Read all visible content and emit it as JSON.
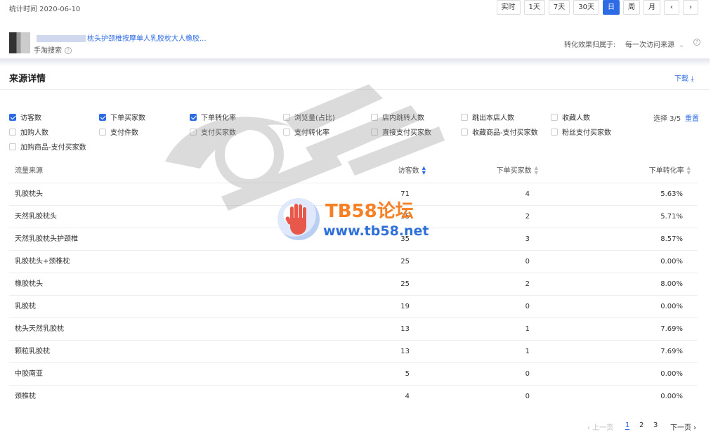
{
  "header": {
    "stat_time": "统计时间 2020-06-10",
    "ranges": [
      "实时",
      "1天",
      "7天",
      "30天",
      "日",
      "周",
      "月"
    ],
    "active_range": "日",
    "prev_label": "‹",
    "next_label": "›"
  },
  "product": {
    "title": "枕头护颈椎按摩单人乳胶枕大人橡胶...",
    "source": "手淘搜索",
    "attribution_label": "转化效果归属于:",
    "attribution_value": "每一次访问来源"
  },
  "section": {
    "title": "来源详情",
    "download_label": "下载"
  },
  "metrics": {
    "items": [
      {
        "label": "访客数",
        "checked": true
      },
      {
        "label": "下单买家数",
        "checked": true
      },
      {
        "label": "下单转化率",
        "checked": true
      },
      {
        "label": "浏览量(占比)",
        "checked": false
      },
      {
        "label": "店内跳转人数",
        "checked": false
      },
      {
        "label": "跳出本店人数",
        "checked": false
      },
      {
        "label": "收藏人数",
        "checked": false
      },
      {
        "label": "加购人数",
        "checked": false
      },
      {
        "label": "支付件数",
        "checked": false
      },
      {
        "label": "支付买家数",
        "checked": false
      },
      {
        "label": "支付转化率",
        "checked": false
      },
      {
        "label": "直接支付买家数",
        "checked": false
      },
      {
        "label": "收藏商品-支付买家数",
        "checked": false
      },
      {
        "label": "粉丝支付买家数",
        "checked": false
      },
      {
        "label": "加购商品-支付买家数",
        "checked": false
      }
    ],
    "select_count": "选择 3/5",
    "reset_label": "重置"
  },
  "table": {
    "headers": [
      "流量来源",
      "访客数",
      "下单买家数",
      "下单转化率"
    ],
    "rows": [
      [
        "乳胶枕头",
        "71",
        "4",
        "5.63%"
      ],
      [
        "天然乳胶枕头",
        "35",
        "2",
        "5.71%"
      ],
      [
        "天然乳胶枕头护颈椎",
        "35",
        "3",
        "8.57%"
      ],
      [
        "乳胶枕头+颈椎枕",
        "25",
        "0",
        "0.00%"
      ],
      [
        "橡胶枕头",
        "25",
        "2",
        "8.00%"
      ],
      [
        "乳胶枕",
        "19",
        "0",
        "0.00%"
      ],
      [
        "枕头天然乳胶枕",
        "13",
        "1",
        "7.69%"
      ],
      [
        "颗粒乳胶枕",
        "13",
        "1",
        "7.69%"
      ],
      [
        "中胶南亚",
        "5",
        "0",
        "0.00%"
      ],
      [
        "颈椎枕",
        "4",
        "0",
        "0.00%"
      ]
    ]
  },
  "pagination": {
    "prev": "‹ 上一页",
    "pages": [
      "1",
      "2",
      "3"
    ],
    "current": "1",
    "next": "下一页 ›"
  },
  "watermark": {
    "site_name": "TB58论坛",
    "site_url": "www.tb58.net"
  }
}
